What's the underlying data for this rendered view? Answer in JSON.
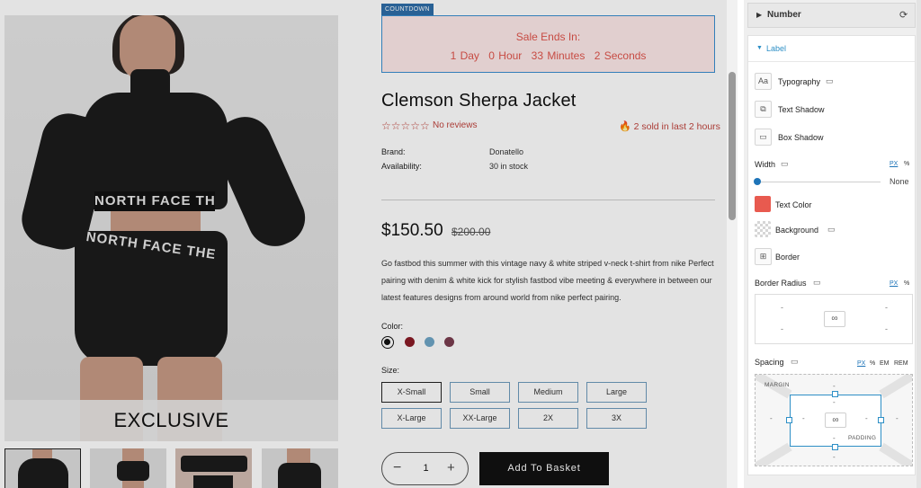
{
  "countdown": {
    "tag": "COUNTDOWN",
    "title": "Sale Ends In:",
    "values": [
      "1 Day",
      "0 Hour",
      "33 Minutes",
      "2 Seconds"
    ],
    "accent_color": "#e0554c"
  },
  "product": {
    "image_caption": "EXCLUSIVE",
    "image_print": "NORTH FACE THE",
    "image_print_2": "NORTH FACE THE",
    "title": "Clemson Sherpa Jacket",
    "stars": "☆☆☆☆☆",
    "reviews": "No reviews",
    "sold": "2 sold in last 2 hours",
    "brand_label": "Brand:",
    "brand": "Donatello",
    "availability_label": "Availability:",
    "availability": "30 in stock",
    "price": "$150.50",
    "old_price": "$200.00",
    "description": "Go fastbod this summer with this vintage navy & white striped v-neck t-shirt from nike Perfect pairing with denim & white kick for stylish fastbod vibe meeting & everywhere in between our latest features designs from around world from nike perfect pairing.",
    "color_label": "Color:",
    "colors": [
      "#111111",
      "#8a1a26",
      "#6fa6c6",
      "#7a3d4f"
    ],
    "size_label": "Size:",
    "sizes": [
      "X-Small",
      "Small",
      "Medium",
      "Large",
      "X-Large",
      "XX-Large",
      "2X",
      "3X"
    ],
    "selected_size": "X-Small",
    "quantity": "1",
    "qty_minus": "−",
    "qty_plus": "+",
    "add_to_basket": "Add To Basket"
  },
  "panel": {
    "number_section": "Number",
    "label_section": "Label",
    "rows": {
      "typography": "Typography",
      "text_shadow": "Text Shadow",
      "box_shadow": "Box Shadow",
      "width": "Width",
      "text_color": "Text Color",
      "background": "Background",
      "border": "Border",
      "border_radius": "Border Radius",
      "spacing": "Spacing"
    },
    "units": {
      "px": "PX",
      "percent": "%",
      "em": "EM",
      "rem": "REM"
    },
    "width_value": "None",
    "width_slider_position": 0,
    "text_color": "#e85a4f",
    "dash": "-",
    "margin_label": "MARGIN",
    "padding_label": "PADDING",
    "icons": {
      "typography": "Aa",
      "text_shadow": "⧉",
      "box_shadow": "▭",
      "border": "⊞",
      "device": "▭",
      "link": "∞",
      "refresh": "⟳",
      "caret_right": "▶",
      "caret_down": "▼",
      "fire": "🔥"
    }
  }
}
